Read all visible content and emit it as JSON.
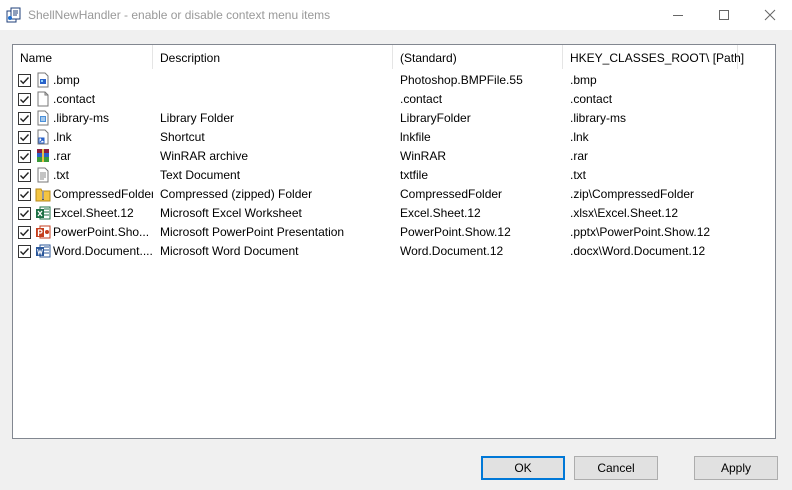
{
  "window": {
    "title": "ShellNewHandler - enable or disable context menu items"
  },
  "columns": [
    "Name",
    "Description",
    "(Standard)",
    "HKEY_CLASSES_ROOT\\ [Path]"
  ],
  "rows": [
    {
      "name": ".bmp",
      "description": "",
      "standard": "Photoshop.BMPFile.55",
      "path": ".bmp",
      "icon": "bmp-file-icon",
      "checked": true
    },
    {
      "name": ".contact",
      "description": "",
      "standard": ".contact",
      "path": ".contact",
      "icon": "blank-file-icon",
      "checked": true
    },
    {
      "name": ".library-ms",
      "description": "Library Folder",
      "standard": "LibraryFolder",
      "path": ".library-ms",
      "icon": "library-file-icon",
      "checked": true
    },
    {
      "name": ".lnk",
      "description": "Shortcut",
      "standard": "lnkfile",
      "path": ".lnk",
      "icon": "shortcut-file-icon",
      "checked": true
    },
    {
      "name": ".rar",
      "description": "WinRAR archive",
      "standard": "WinRAR",
      "path": ".rar",
      "icon": "winrar-icon",
      "checked": true
    },
    {
      "name": ".txt",
      "description": "Text Document",
      "standard": "txtfile",
      "path": ".txt",
      "icon": "text-file-icon",
      "checked": true
    },
    {
      "name": "CompressedFolder",
      "description": "Compressed (zipped) Folder",
      "standard": "CompressedFolder",
      "path": ".zip\\CompressedFolder",
      "icon": "zip-folder-icon",
      "checked": true
    },
    {
      "name": "Excel.Sheet.12",
      "description": "Microsoft Excel Worksheet",
      "standard": "Excel.Sheet.12",
      "path": ".xlsx\\Excel.Sheet.12",
      "icon": "excel-icon",
      "checked": true
    },
    {
      "name": "PowerPoint.Sho...",
      "description": "Microsoft PowerPoint Presentation",
      "standard": "PowerPoint.Show.12",
      "path": ".pptx\\PowerPoint.Show.12",
      "icon": "powerpoint-icon",
      "checked": true
    },
    {
      "name": "Word.Document....",
      "description": "Microsoft Word Document",
      "standard": "Word.Document.12",
      "path": ".docx\\Word.Document.12",
      "icon": "word-icon",
      "checked": true
    }
  ],
  "buttons": {
    "ok": "OK",
    "cancel": "Cancel",
    "apply": "Apply"
  },
  "colors": {
    "accent": "#0078d7",
    "excel": "#1d7044",
    "powerpoint": "#c43e1c",
    "word": "#2b579a"
  }
}
